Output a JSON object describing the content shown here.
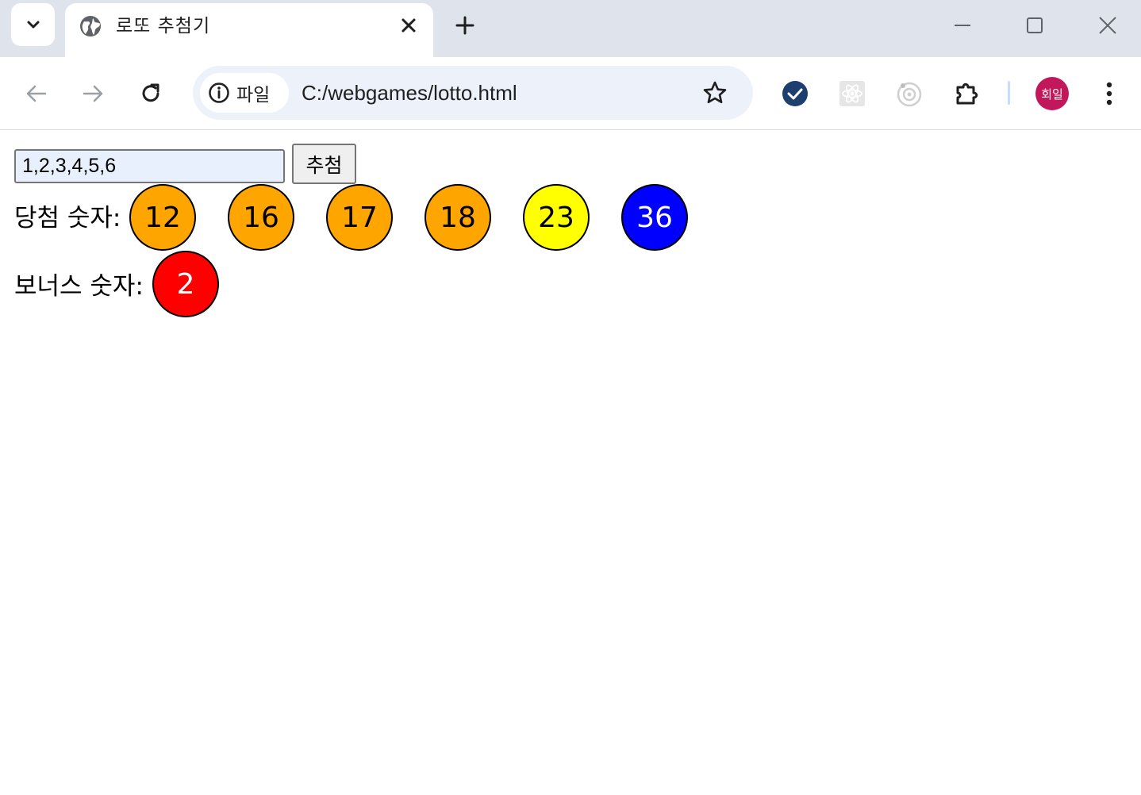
{
  "browser": {
    "tab": {
      "title": "로또 추첨기"
    },
    "address": {
      "chip_label": "파일",
      "url": "C:/webgames/lotto.html"
    },
    "profile": {
      "avatar_text": "회일",
      "avatar_color": "#c2185b"
    },
    "icons": [
      "tab-search-icon",
      "globe-icon",
      "close-icon",
      "plus-icon",
      "minimize-icon",
      "maximize-icon",
      "close-window-icon",
      "back-arrow-icon",
      "forward-arrow-icon",
      "reload-icon",
      "info-icon",
      "star-icon",
      "checkmark-extension-icon",
      "react-extension-icon",
      "camera-extension-icon",
      "puzzle-icon",
      "more-vert-icon"
    ]
  },
  "page": {
    "input_value": "1,2,3,4,5,6",
    "draw_button": "추첨",
    "winning_label": "당첨 숫자:",
    "bonus_label": "보너스 숫자:",
    "winning_numbers": [
      {
        "value": "12",
        "color": "#ffa500",
        "text_color": "#000000"
      },
      {
        "value": "16",
        "color": "#ffa500",
        "text_color": "#000000"
      },
      {
        "value": "17",
        "color": "#ffa500",
        "text_color": "#000000"
      },
      {
        "value": "18",
        "color": "#ffa500",
        "text_color": "#000000"
      },
      {
        "value": "23",
        "color": "#ffff00",
        "text_color": "#000000"
      },
      {
        "value": "36",
        "color": "#0000ff",
        "text_color": "#ffffff"
      }
    ],
    "bonus_number": {
      "value": "2",
      "color": "#ff0000",
      "text_color": "#ffffff"
    }
  }
}
